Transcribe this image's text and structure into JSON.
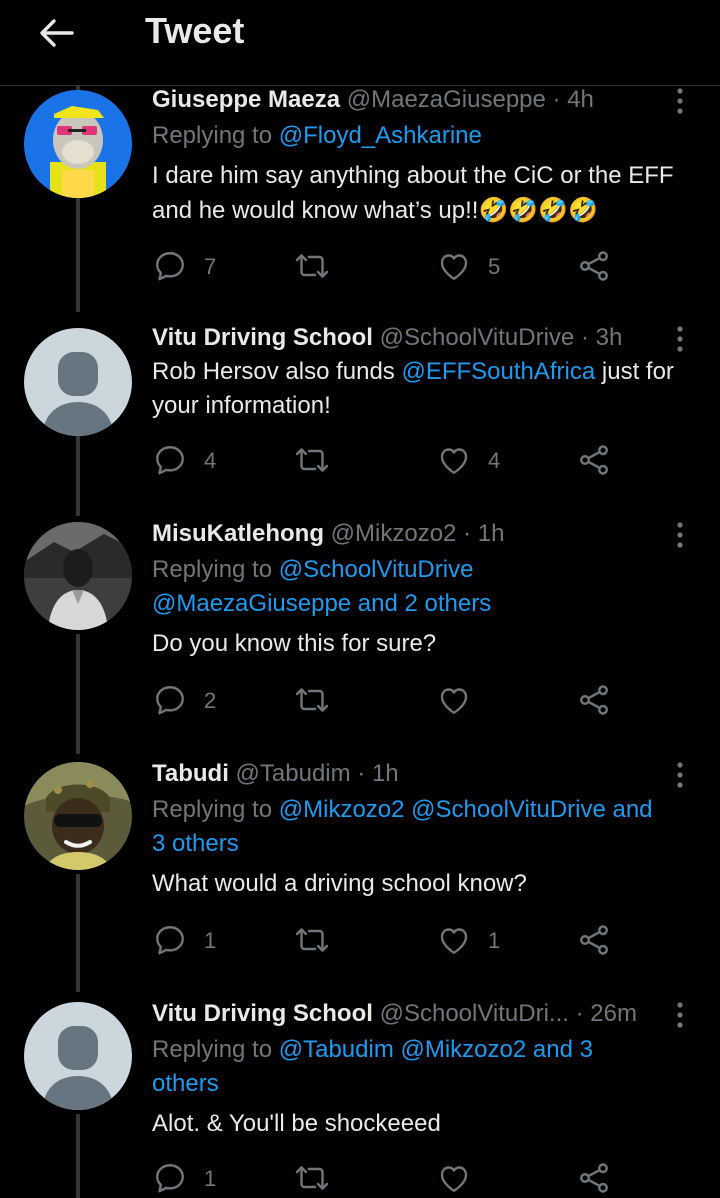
{
  "header": {
    "title": "Tweet"
  },
  "tweets": [
    {
      "name": "Giuseppe Maeza",
      "handle": "@MaezaGiuseppe",
      "time": "· 4h",
      "replying_prefix": "Replying to ",
      "replying_line1": "@Floyd_Ashkarine",
      "text_line1": "I dare him say anything about the CiC or the EFF",
      "text_line2": "and he would know what’s up!!🤣🤣🤣🤣",
      "replies": "7",
      "retweets": "",
      "likes": "5"
    },
    {
      "name": "Vitu Driving School",
      "handle": "@SchoolVituDrive",
      "time": "· 3h",
      "text_line1_pre": "Rob Hersov also funds ",
      "text_line1_mention": "@EFFSouthAfrica",
      "text_line1_post": " just for",
      "text_line2": "your information!",
      "replies": "4",
      "retweets": "",
      "likes": "4"
    },
    {
      "name": "MisuKatlehong",
      "handle": "@Mikzozo2",
      "time": "· 1h",
      "replying_prefix": "Replying to ",
      "replying_line1": "@SchoolVituDrive",
      "replying_line2": "@MaezaGiuseppe and 2 others",
      "text_line1": "Do you know this for sure?",
      "replies": "2",
      "retweets": "",
      "likes": ""
    },
    {
      "name": "Tabudi",
      "handle": "@Tabudim",
      "time": "· 1h",
      "replying_prefix": "Replying to ",
      "replying_line1": "@Mikzozo2 @SchoolVituDrive and",
      "replying_line2": "3 others",
      "text_line1": "What would a driving school know?",
      "replies": "1",
      "retweets": "",
      "likes": "1"
    },
    {
      "name": "Vitu Driving School",
      "handle": "@SchoolVituDri...",
      "time": "· 26m",
      "replying_prefix": "Replying to ",
      "replying_line1": "@Tabudim @Mikzozo2 and 3",
      "replying_line2": "others",
      "text_line1": "Alot. & You'll be shockeeed",
      "replies": "1",
      "retweets": "",
      "likes": ""
    }
  ],
  "icons": {
    "back": "arrow-left-icon",
    "more": "more-vertical-icon",
    "reply": "reply-icon",
    "retweet": "retweet-icon",
    "like": "heart-icon",
    "share": "share-icon"
  },
  "colors": {
    "background": "#000000",
    "text": "#e7e9ea",
    "secondary": "#71767b",
    "link": "#1d9bf0"
  }
}
